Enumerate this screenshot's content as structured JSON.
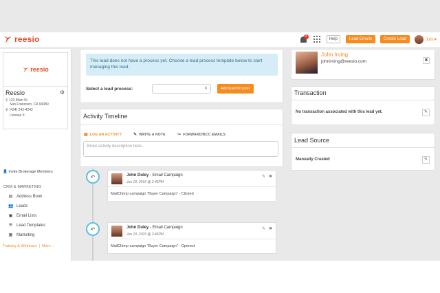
{
  "brand": {
    "name": "reesio",
    "color": "#e84a27"
  },
  "topbar": {
    "notification_count": "3",
    "help_label": "Help",
    "lead_emails_label": "Lead Emails",
    "create_lead_label": "Create Lead",
    "user_name": "John"
  },
  "sidebar": {
    "logo_word": "reesio",
    "title": "Reesio",
    "address_line1": "123 Main St",
    "address_line2": "San Francisco, CA 94080",
    "phone": "(434) 242-4242",
    "license": "License #:",
    "invite_label": "Invite Brokerage Members",
    "section_title": "CRM & MARKETING",
    "nav": [
      {
        "label": "Address Book",
        "icon": "book-icon"
      },
      {
        "label": "Leads",
        "icon": "users-icon"
      },
      {
        "label": "Email Lists",
        "icon": "email-list-icon"
      },
      {
        "label": "Lead Templates",
        "icon": "list-icon"
      },
      {
        "label": "Marketing",
        "icon": "chart-icon"
      }
    ],
    "footer_link1": "Training & Webinars",
    "footer_sep": "|",
    "footer_link2": "More..."
  },
  "process": {
    "notice": "This lead does not have a process yet. Choose a lead process template below to start managing this lead.",
    "select_label": "Select a lead process:",
    "select_value": "",
    "add_button": "Add lead Process"
  },
  "timeline": {
    "title": "Activity Timeline",
    "tabs": [
      {
        "label": "LOG AN ACTIVITY",
        "icon": "calendar-icon",
        "active": true
      },
      {
        "label": "WRITE A NOTE",
        "icon": "pencil-icon",
        "active": false
      },
      {
        "label": "FORWARD/BCC EMAILS",
        "icon": "share-icon",
        "active": false
      }
    ],
    "input_placeholder": "Enter activity description here...",
    "activities": [
      {
        "author": "John Duley",
        "type": " - Email Campaign",
        "date": "Jun 19, 2015 @ 2:46PM",
        "body": "MailChimp campaign \"Buyer Campaign\" - Clicked"
      },
      {
        "author": "John Duley",
        "type": " - Email Campaign",
        "date": "Jun 19, 2015 @ 2:46PM",
        "body": "MailChimp campaign \"Buyer Campaign\" - Opened"
      }
    ]
  },
  "contact": {
    "name": "John Irving",
    "email": "johnirving@reesio.com"
  },
  "transaction": {
    "title": "Transaction",
    "text": "No transaction associated with this lead yet."
  },
  "lead_source": {
    "title": "Lead Source",
    "value": "Manually Created"
  },
  "colors": {
    "accent": "#f68b1f",
    "info_bg": "#d6edf7",
    "timeline_node": "#5bc0de"
  }
}
